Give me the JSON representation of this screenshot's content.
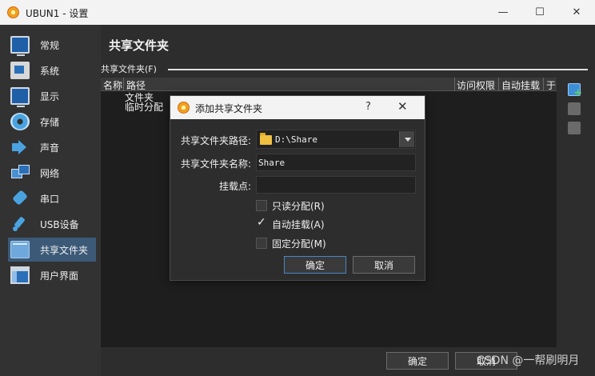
{
  "window": {
    "title": "UBUN1 - 设置"
  },
  "window_controls": {
    "minimize": "—",
    "maximize": "☐",
    "close": "✕"
  },
  "sidebar": {
    "items": [
      {
        "label": "常规",
        "icon": "monitor-icon"
      },
      {
        "label": "系统",
        "icon": "chip-icon"
      },
      {
        "label": "显示",
        "icon": "display-icon"
      },
      {
        "label": "存储",
        "icon": "disk-icon"
      },
      {
        "label": "声音",
        "icon": "speaker-icon"
      },
      {
        "label": "网络",
        "icon": "network-icon"
      },
      {
        "label": "串口",
        "icon": "serial-icon"
      },
      {
        "label": "USB设备",
        "icon": "usb-icon"
      },
      {
        "label": "共享文件夹",
        "icon": "folder-icon",
        "selected": true
      },
      {
        "label": "用户界面",
        "icon": "ui-icon"
      }
    ]
  },
  "main": {
    "title": "共享文件夹",
    "group_label": "共享文件夹(F)",
    "table": {
      "columns": [
        "名称",
        "路径",
        "访问权限",
        "自动挂载",
        "于"
      ],
      "tree": [
        "文件夹",
        "临时分配"
      ]
    }
  },
  "footer": {
    "ok_label": "确定",
    "cancel_label": "取消"
  },
  "watermark": "CSDN @一帮刷明月",
  "dialog": {
    "title": "添加共享文件夹",
    "help": "?",
    "close": "✕",
    "path_label": "共享文件夹路径:",
    "path_value": "D:\\Share",
    "name_label": "共享文件夹名称:",
    "name_value": "Share",
    "mount_label": "挂载点:",
    "mount_value": "",
    "readonly_label": "只读分配(R)",
    "automount_label": "自动挂载(A)",
    "permanent_label": "固定分配(M)",
    "ok_label": "确定",
    "cancel_label": "取消"
  },
  "colors": {
    "accent": "#3c5a78",
    "background": "#2d2d2d",
    "titlebar": "#f3f3f3"
  }
}
